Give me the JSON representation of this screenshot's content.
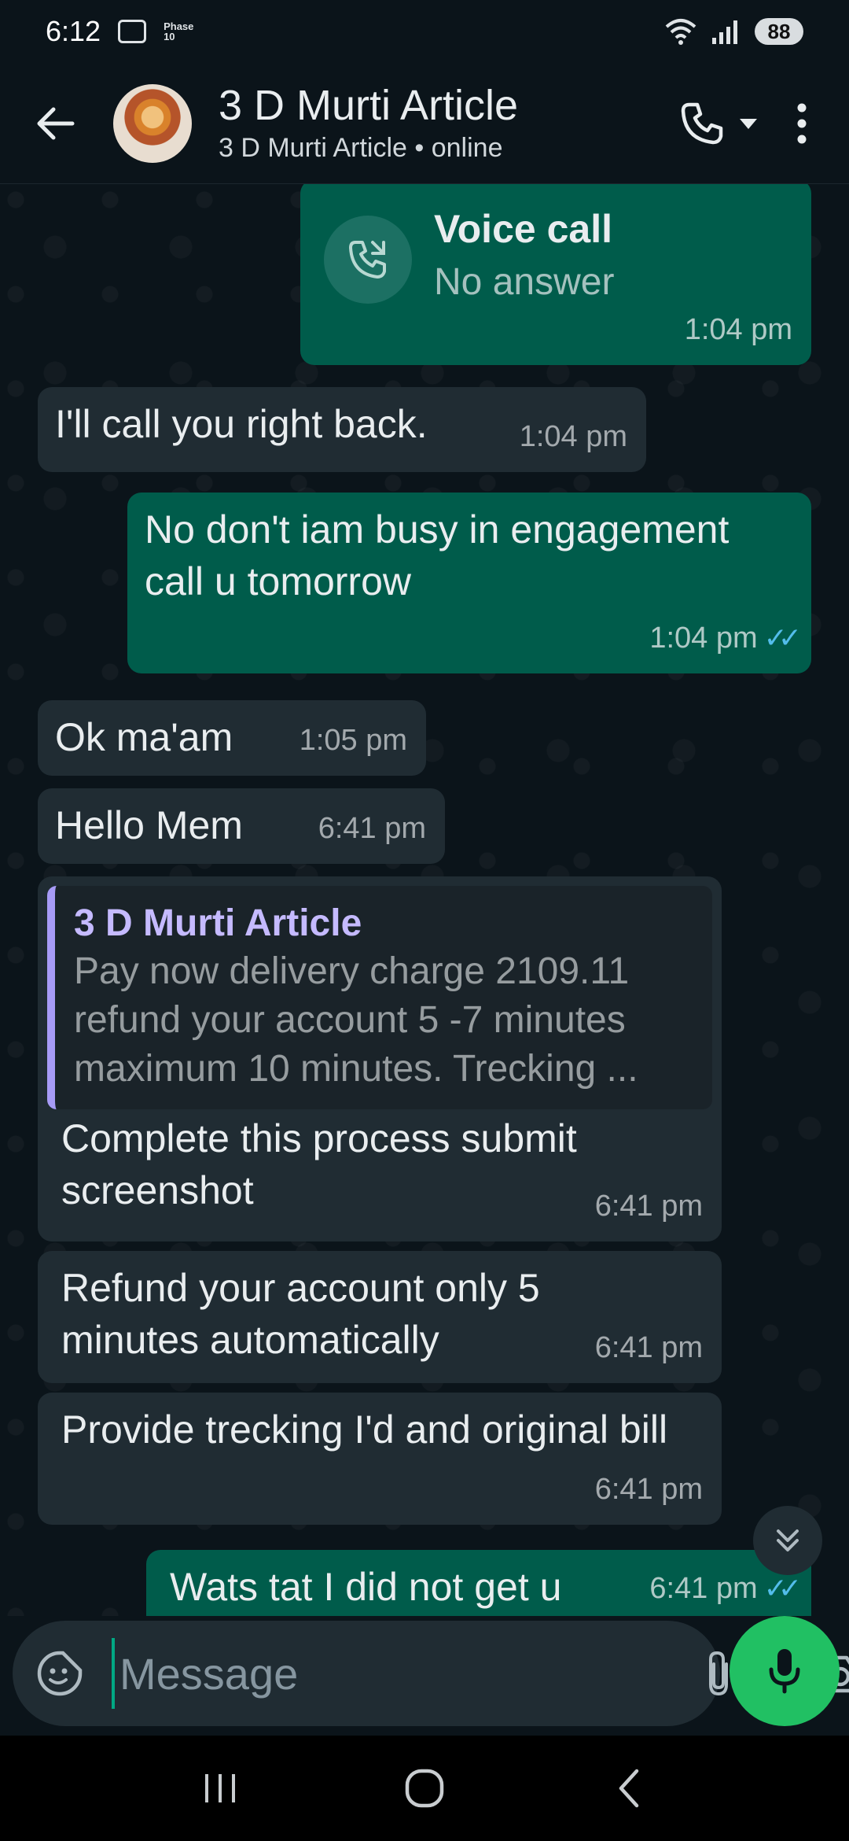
{
  "status_bar": {
    "time": "6:12",
    "phase_label": "Phase 10",
    "battery": "88"
  },
  "header": {
    "title": "3 D Murti Article",
    "subtitle": "3 D Murti Article • online",
    "back_icon": "arrow-left-icon",
    "call_icon": "phone-icon",
    "menu_icon": "more-vert-icon"
  },
  "messages": [
    {
      "type": "call",
      "direction": "out",
      "title": "Voice call",
      "subtitle": "No answer",
      "time": "1:04 pm"
    },
    {
      "type": "text",
      "direction": "in",
      "text": "I'll call you right back.",
      "time": "1:04 pm"
    },
    {
      "type": "text",
      "direction": "out",
      "text": "No don't iam busy in engagement call u tomorrow",
      "time": "1:04 pm",
      "ticks": "✓✓"
    },
    {
      "type": "text",
      "direction": "in",
      "text": "Ok ma'am",
      "time": "1:05 pm"
    },
    {
      "type": "text",
      "direction": "in",
      "text": "Hello Mem",
      "time": "6:41 pm"
    },
    {
      "type": "reply",
      "direction": "in",
      "quote_name": "3 D Murti Article",
      "quote_text": "Pay now delivery charge 2109.11 refund your account 5 -7 minutes maximum 10 minutes. Trecking ...",
      "text": "Complete this process submit screenshot",
      "time": "6:41 pm"
    },
    {
      "type": "text",
      "direction": "in",
      "text": "Refund your account only 5 minutes automatically",
      "time": "6:41 pm"
    },
    {
      "type": "text",
      "direction": "in",
      "text": "Provide trecking I'd and original bill",
      "time": "6:41 pm"
    },
    {
      "type": "text",
      "direction": "out",
      "text": "Wats tat I did not get u",
      "time": "6:41 pm",
      "ticks": "✓✓"
    }
  ],
  "input": {
    "placeholder": "Message"
  },
  "colors": {
    "background": "#0b141a",
    "incoming_bubble": "#202c33",
    "outgoing_bubble": "#005c4b",
    "accent_green": "#21c063",
    "read_ticks": "#53bdeb",
    "quote_bar": "#a79bf6"
  }
}
